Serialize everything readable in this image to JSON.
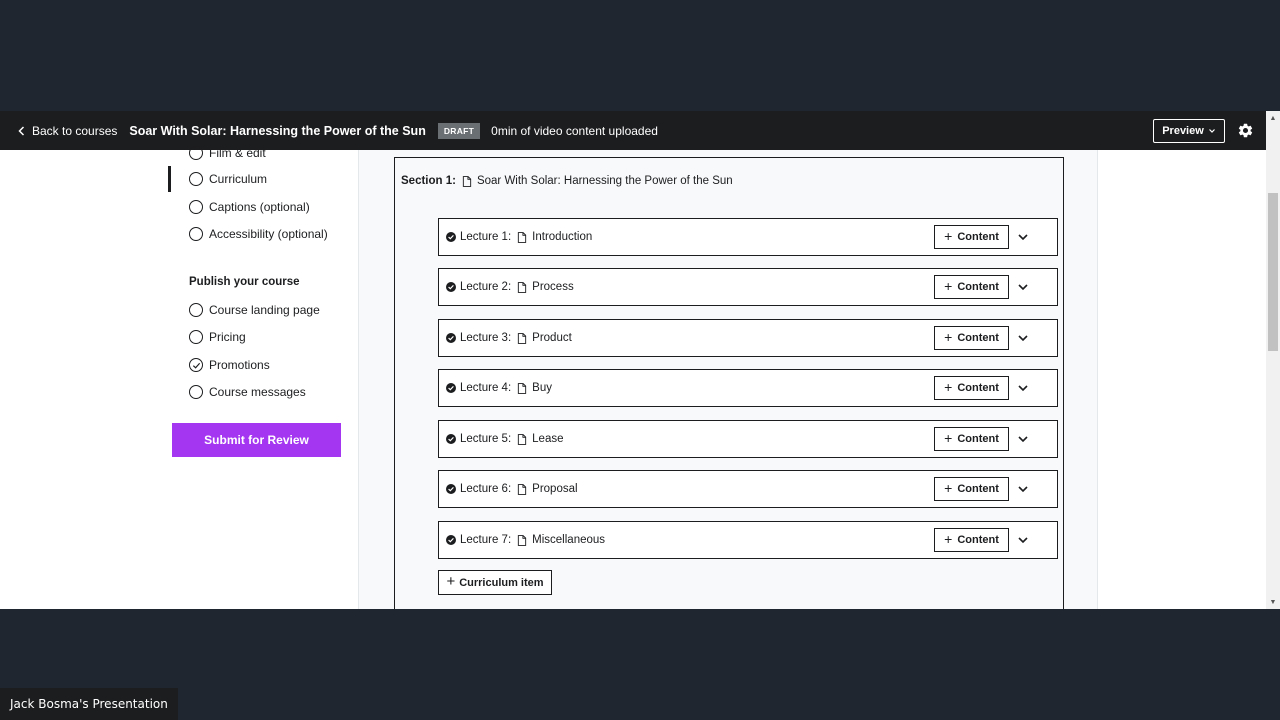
{
  "topbar": {
    "back_label": "Back to courses",
    "course_title": "Soar With Solar: Harnessing the Power of the Sun",
    "status_badge": "DRAFT",
    "upload_status": "0min of video content uploaded",
    "preview_label": "Preview",
    "icons": {
      "back": "chevron-left-icon",
      "preview_caret": "chevron-down-icon",
      "settings": "gear-icon"
    }
  },
  "sidebar": {
    "partial_item": {
      "label": "Film & edit",
      "completed": false
    },
    "plan_items": [
      {
        "label": "Curriculum",
        "completed": false,
        "active": true
      },
      {
        "label": "Captions (optional)",
        "completed": false
      },
      {
        "label": "Accessibility (optional)",
        "completed": false
      }
    ],
    "publish_heading": "Publish your course",
    "publish_items": [
      {
        "label": "Course landing page",
        "completed": false
      },
      {
        "label": "Pricing",
        "completed": false
      },
      {
        "label": "Promotions",
        "completed": true
      },
      {
        "label": "Course messages",
        "completed": false
      }
    ],
    "submit_label": "Submit for Review",
    "accent_color": "#a435f0"
  },
  "section": {
    "label": "Section 1:",
    "title": "Soar With Solar: Harnessing the Power of the Sun",
    "lectures": [
      {
        "label": "Lecture 1:",
        "title": "Introduction",
        "content_label": "Content"
      },
      {
        "label": "Lecture 2:",
        "title": "Process",
        "content_label": "Content"
      },
      {
        "label": "Lecture 3:",
        "title": "Product",
        "content_label": "Content"
      },
      {
        "label": "Lecture 4:",
        "title": "Buy",
        "content_label": "Content"
      },
      {
        "label": "Lecture 5:",
        "title": "Lease",
        "content_label": "Content"
      },
      {
        "label": "Lecture 6:",
        "title": "Proposal",
        "content_label": "Content"
      },
      {
        "label": "Lecture 7:",
        "title": "Miscellaneous",
        "content_label": "Content"
      }
    ],
    "add_item_label": "Curriculum item"
  },
  "presenter": {
    "label": "Jack Bosma's Presentation"
  }
}
